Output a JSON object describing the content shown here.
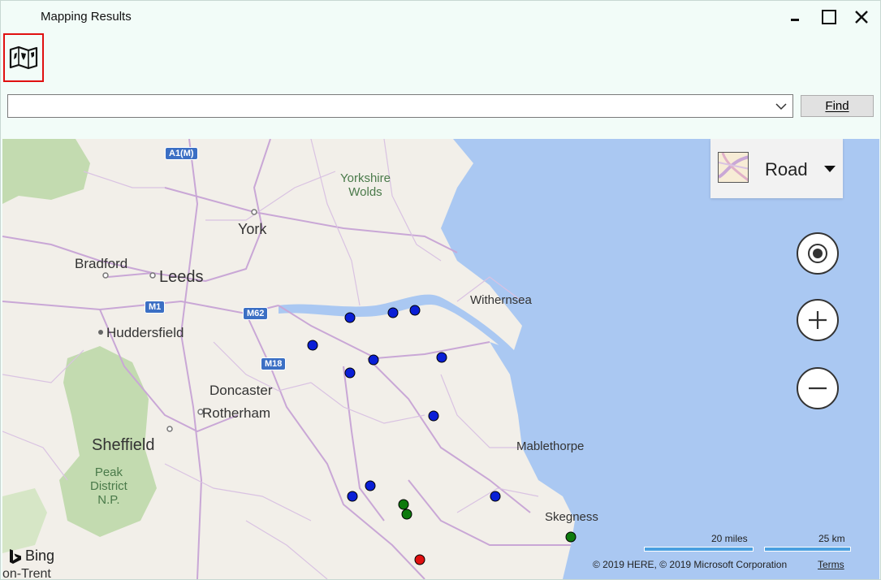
{
  "window": {
    "title": "Mapping Results"
  },
  "toolbar": {
    "map_icon": "folded-map-icon"
  },
  "search": {
    "value": "",
    "find_label": "Find"
  },
  "map_style": {
    "selected": "Road"
  },
  "map_labels": {
    "road_a1m": "A1(M)",
    "road_m1": "M1",
    "road_m62": "M62",
    "road_m18": "M18",
    "yorkshire_wolds": "Yorkshire\nWolds",
    "york": "York",
    "bradford": "Bradford",
    "leeds": "Leeds",
    "huddersfield": "Huddersfield",
    "doncaster": "Doncaster",
    "rotherham": "Rotherham",
    "sheffield": "Sheffield",
    "peak_district": "Peak\nDistrict\nN.P.",
    "withernsea": "Withernsea",
    "mablethorpe": "Mablethorpe",
    "skegness": "Skegness",
    "on_trent": "on-Trent"
  },
  "attribution": {
    "bing": "Bing",
    "scale_miles": "20 miles",
    "scale_km": "25 km",
    "copyright": "© 2019 HERE, © 2019 Microsoft Corporation",
    "terms": "Terms"
  },
  "colors": {
    "pin_blue": "#0a1fd6",
    "pin_green": "#0d7a0d",
    "pin_red": "#e01010",
    "sea": "#aac8f2",
    "land": "#f2efe9",
    "park": "#c3dbb0"
  }
}
